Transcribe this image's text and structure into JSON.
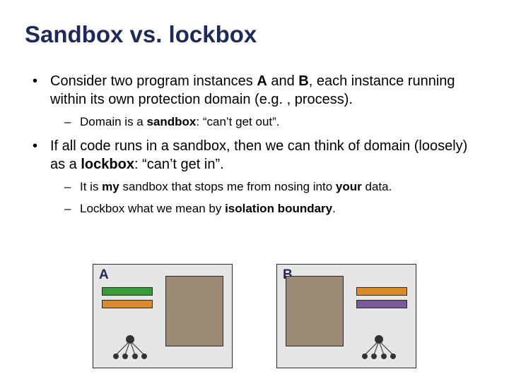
{
  "title": "Sandbox vs. lockbox",
  "bullets": {
    "b1_pre": "Consider two program instances ",
    "b1_A": "A",
    "b1_mid": " and ",
    "b1_B": "B",
    "b1_post": ", each instance running within its own protection domain (e.g. , process).",
    "b1_sub_pre": "Domain is a ",
    "b1_sub_bold": "sandbox",
    "b1_sub_post": ": “can’t get out”.",
    "b2_pre": "If all code runs in a sandbox, then we can think of domain (loosely) as a ",
    "b2_bold": "lockbox",
    "b2_post": ": “can’t get in”.",
    "b2_sub1_pre": "It is ",
    "b2_sub1_bold1": "my",
    "b2_sub1_mid": " sandbox that stops me from nosing into ",
    "b2_sub1_bold2": "your",
    "b2_sub1_post": " data.",
    "b2_sub2_pre": "Lockbox what we mean by ",
    "b2_sub2_bold": "isolation boundary",
    "b2_sub2_post": "."
  },
  "diagram": {
    "labelA": "A",
    "labelB": "B"
  }
}
